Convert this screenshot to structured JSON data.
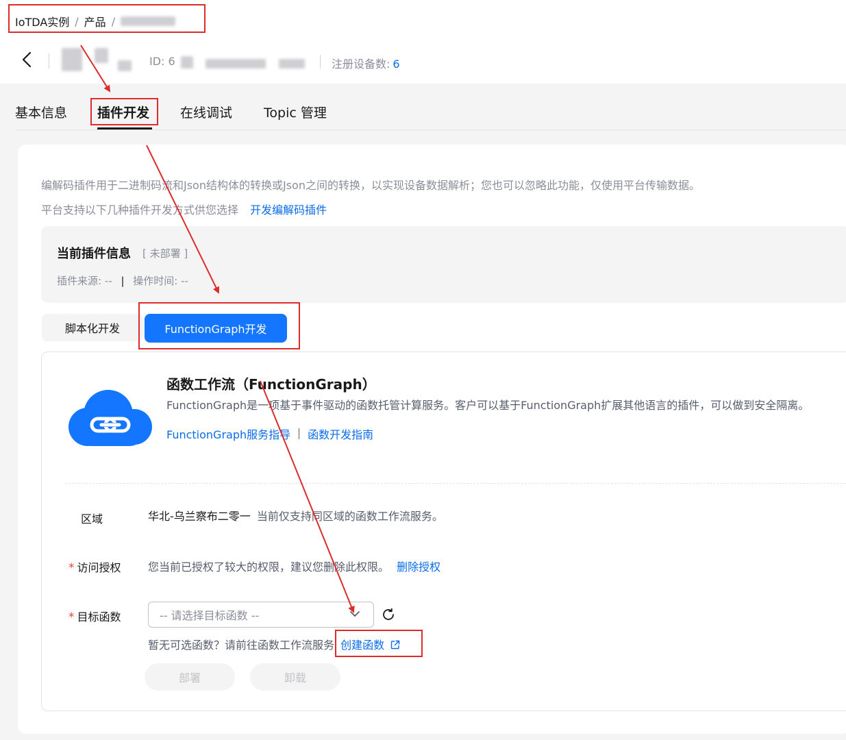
{
  "breadcrumb": {
    "items": [
      "IoTDA实例",
      "产品"
    ],
    "separator": "/"
  },
  "product": {
    "id_label": "ID: 6",
    "device_count_label": "注册设备数:",
    "device_count_value": "6"
  },
  "tabs": [
    {
      "label": "基本信息"
    },
    {
      "label": "插件开发",
      "active": true
    },
    {
      "label": "在线调试"
    },
    {
      "label": "Topic 管理"
    }
  ],
  "intro": {
    "line1": "编解码插件用于二进制码流和Json结构体的转换或Json之间的转换，以实现设备数据解析；您也可以忽略此功能，仅使用平台传输数据。",
    "line2": "平台支持以下几种插件开发方式供您选择",
    "line2_link": "开发编解码插件"
  },
  "current_plugin": {
    "title": "当前插件信息",
    "status": "[ 未部署 ]",
    "source_label": "插件来源: --",
    "time_label": "操作时间: --",
    "meta_sep": "|"
  },
  "dev_modes": {
    "script": "脚本化开发",
    "functiongraph": "FunctionGraph开发"
  },
  "functiongraph": {
    "title": "函数工作流（FunctionGraph）",
    "description": "FunctionGraph是一项基于事件驱动的函数托管计算服务。客户可以基于FunctionGraph扩展其他语言的插件，可以做到安全隔离。",
    "link1": "FunctionGraph服务指导",
    "link2": "函数开发指南"
  },
  "form": {
    "region_label": "区域",
    "region_value": "华北-乌兰察布二零一",
    "region_note": "当前仅支持同区域的函数工作流服务。",
    "auth_label": "访问授权",
    "auth_text": "您当前已授权了较大的权限，建议您删除此权限。",
    "auth_link": "删除授权",
    "target_label": "目标函数",
    "target_placeholder": "-- 请选择目标函数 --",
    "hint_text": "暂无可选函数？请前往函数工作流服务",
    "hint_link": "创建函数",
    "required_mark": "*"
  },
  "buttons": {
    "deploy": "部署",
    "uninstall": "卸载"
  },
  "colors": {
    "brand_blue": "#1476ff",
    "link_blue": "#0a6ce9",
    "annotation_red": "#dd2b2b",
    "cloud_blue": "#1476ff"
  }
}
